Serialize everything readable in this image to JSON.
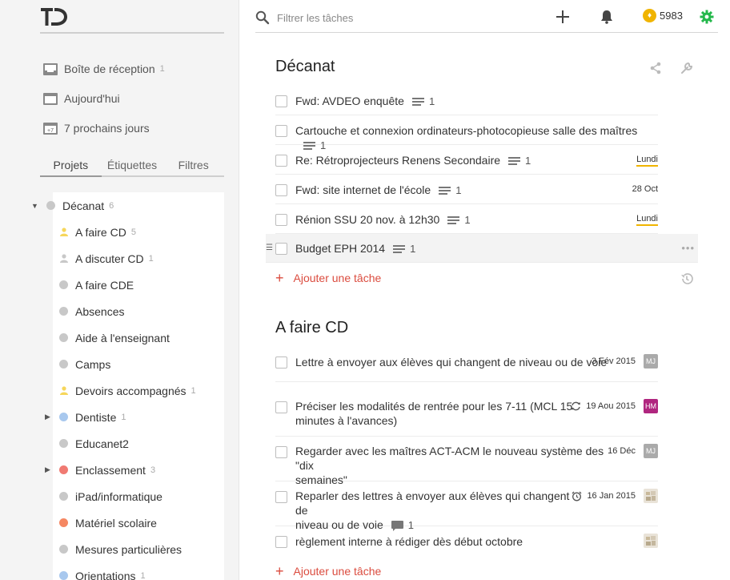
{
  "app": {
    "logo_text": "TD"
  },
  "sidebar": {
    "nav": [
      {
        "label": "Boîte de réception",
        "count": "1",
        "icon": "inbox-icon"
      },
      {
        "label": "Aujourd'hui",
        "count": "",
        "icon": "calendar-icon"
      },
      {
        "label": "7 prochains jours",
        "count": "",
        "icon": "calendar-week-icon",
        "badge": "+7"
      }
    ],
    "tabs": [
      "Projets",
      "Étiquettes",
      "Filtres"
    ],
    "projects": [
      {
        "label": "Décanat",
        "count": "6",
        "color": "#c8c8c8",
        "kind": "root",
        "arrow": "down"
      },
      {
        "label": "A faire CD",
        "count": "5",
        "color": "#f6d65b",
        "kind": "person"
      },
      {
        "label": "A discuter CD",
        "count": "1",
        "color": "#c8c8c8",
        "kind": "person"
      },
      {
        "label": "A faire CDE",
        "count": "",
        "color": "#c8c8c8",
        "kind": "dot"
      },
      {
        "label": "Absences",
        "count": "",
        "color": "#c8c8c8",
        "kind": "dot"
      },
      {
        "label": "Aide à l'enseignant",
        "count": "",
        "color": "#c8c8c8",
        "kind": "dot"
      },
      {
        "label": "Camps",
        "count": "",
        "color": "#c8c8c8",
        "kind": "dot"
      },
      {
        "label": "Devoirs accompagnés",
        "count": "1",
        "color": "#f6d65b",
        "kind": "person"
      },
      {
        "label": "Dentiste",
        "count": "1",
        "color": "#a8c8ee",
        "kind": "dot",
        "arrow": "right"
      },
      {
        "label": "Educanet2",
        "count": "",
        "color": "#c8c8c8",
        "kind": "dot"
      },
      {
        "label": "Enclassement",
        "count": "3",
        "color": "#f07a72",
        "kind": "dot",
        "arrow": "right"
      },
      {
        "label": "iPad/informatique",
        "count": "",
        "color": "#c8c8c8",
        "kind": "dot"
      },
      {
        "label": "Matériel scolaire",
        "count": "",
        "color": "#f58762",
        "kind": "dot"
      },
      {
        "label": "Mesures particulières",
        "count": "",
        "color": "#c8c8c8",
        "kind": "dot"
      },
      {
        "label": "Orientations",
        "count": "1",
        "color": "#a8c8ee",
        "kind": "dot"
      }
    ]
  },
  "topbar": {
    "search_placeholder": "Filtrer les tâches",
    "karma": "5983",
    "colors": {
      "karma": "#f0b400",
      "settings": "#25b84c"
    }
  },
  "main": {
    "sections": [
      {
        "title": "Décanat",
        "tasks": [
          {
            "text": "Fwd: AVDEO enquête",
            "notes": "1",
            "date": ""
          },
          {
            "text": "Cartouche et connexion ordinateurs-photocopieuse salle des maîtres",
            "notes": "1",
            "date": ""
          },
          {
            "text": "Re: Rétroprojecteurs Renens Secondaire",
            "notes": "1",
            "date": "Lundi"
          },
          {
            "text": "Fwd: site internet de l'école",
            "notes": "1",
            "date": "28 Oct"
          },
          {
            "text": "Rénion SSU 20 nov. à 12h30",
            "notes": "1",
            "date": "Lundi"
          },
          {
            "text": "Budget EPH 2014",
            "notes": "1",
            "date": ""
          }
        ],
        "add_label": "Ajouter une tâche"
      },
      {
        "title": "A faire CD",
        "tasks": [
          {
            "text": "Lettre à envoyer aux élèves qui changent de niveau ou de voie",
            "date": "3 Fév 2015",
            "avatar": "MJ"
          },
          {
            "line1": "Préciser les modalités de rentrée pour les 7-11 (MCL 15",
            "line2": "minutes à l'avances)",
            "date": "19 Aou 2015",
            "avatar": "HM"
          },
          {
            "line1": "Regarder avec les maîtres ACT-ACM le nouveau système des \"dix",
            "line2": "semaines\"",
            "date": "16 Déc",
            "avatar": "MJ"
          },
          {
            "line1": "Reparler des lettres à envoyer aux élèves qui changent de",
            "line2": "niveau ou de voie",
            "comments": "1",
            "date": "16 Jan 2015"
          },
          {
            "text": "règlement interne à rédiger dès début octobre",
            "date": ""
          }
        ],
        "add_label": "Ajouter une tâche"
      }
    ]
  }
}
